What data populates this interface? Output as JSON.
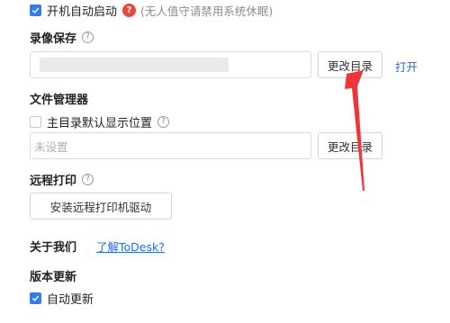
{
  "autostart": {
    "label": "开机自动启动",
    "note": "(无人值守请禁用系统休眠)",
    "checked": true
  },
  "recording": {
    "title": "录像保存",
    "change_dir_label": "更改目录",
    "open_label": "打开"
  },
  "file_manager": {
    "title": "文件管理器",
    "default_location_label": "主目录默认显示位置",
    "path_placeholder": "未设置",
    "change_dir_label": "更改目录"
  },
  "remote_print": {
    "title": "远程打印",
    "install_driver_label": "安装远程打印机驱动"
  },
  "about": {
    "title": "关于我们",
    "learn_more_label": "了解ToDesk?"
  },
  "version_update": {
    "title": "版本更新",
    "auto_update_label": "自动更新",
    "checked": true
  },
  "colors": {
    "accent": "#2f7df6",
    "link": "#1f6fe0",
    "warning": "#e8473b",
    "annotation_arrow": "#f0353a"
  }
}
